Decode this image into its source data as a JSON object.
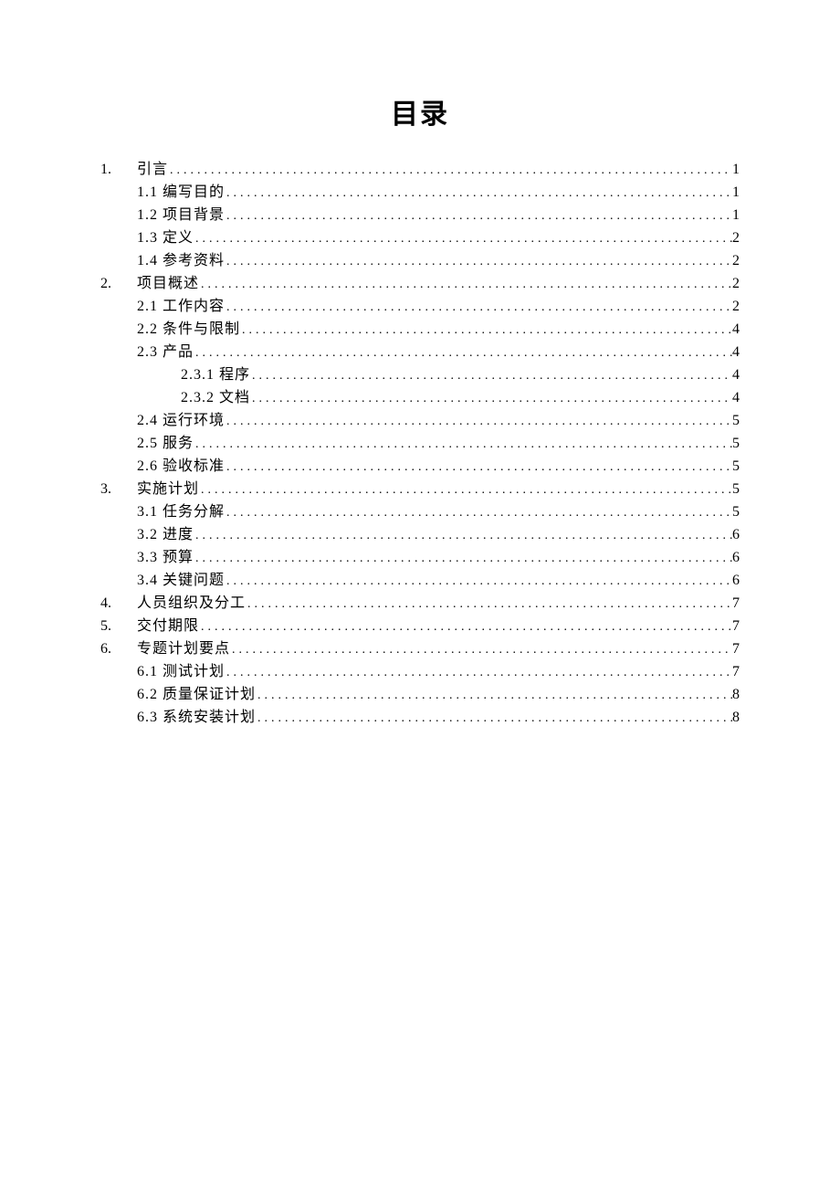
{
  "title": "目录",
  "entries": [
    {
      "level": 1,
      "number": "1.",
      "text": "引言",
      "page": "1"
    },
    {
      "level": 2,
      "number": "1.1",
      "text": "编写目的",
      "page": "1"
    },
    {
      "level": 2,
      "number": "1.2",
      "text": "项目背景",
      "page": "1"
    },
    {
      "level": 2,
      "number": "1.3",
      "text": "定义",
      "page": "2"
    },
    {
      "level": 2,
      "number": "1.4",
      "text": "参考资料",
      "page": "2"
    },
    {
      "level": 1,
      "number": "2.",
      "text": "项目概述",
      "page": "2"
    },
    {
      "level": 2,
      "number": "2.1",
      "text": "工作内容",
      "page": "2"
    },
    {
      "level": 2,
      "number": "2.2",
      "text": "条件与限制",
      "page": "4"
    },
    {
      "level": 2,
      "number": "2.3",
      "text": "产品",
      "page": "4"
    },
    {
      "level": 3,
      "number": "2.3.1",
      "text": "程序 ",
      "page": "4"
    },
    {
      "level": 3,
      "number": "2.3.2",
      "text": "文档 ",
      "page": "4"
    },
    {
      "level": 2,
      "number": "2.4",
      "text": "运行环境",
      "page": "5"
    },
    {
      "level": 2,
      "number": "2.5",
      "text": "服务",
      "page": "5"
    },
    {
      "level": 2,
      "number": "2.6",
      "text": "验收标准",
      "page": "5"
    },
    {
      "level": 1,
      "number": "3.",
      "text": "实施计划",
      "page": "5"
    },
    {
      "level": 2,
      "number": "3.1",
      "text": "任务分解",
      "page": "5"
    },
    {
      "level": 2,
      "number": "3.2",
      "text": "进度",
      "page": "6"
    },
    {
      "level": 2,
      "number": "3.3",
      "text": "预算",
      "page": "6"
    },
    {
      "level": 2,
      "number": "3.4",
      "text": "关键问题",
      "page": "6"
    },
    {
      "level": 1,
      "number": "4.",
      "text": "人员组织及分工",
      "page": "7"
    },
    {
      "level": 1,
      "number": "5.",
      "text": "交付期限",
      "page": "7"
    },
    {
      "level": 1,
      "number": "6.",
      "text": "专题计划要点",
      "page": "7"
    },
    {
      "level": 2,
      "number": "6.1",
      "text": "测试计划",
      "page": "7"
    },
    {
      "level": 2,
      "number": "6.2",
      "text": "质量保证计划",
      "page": "8"
    },
    {
      "level": 2,
      "number": "6.3",
      "text": "系统安装计划",
      "page": "8"
    }
  ]
}
